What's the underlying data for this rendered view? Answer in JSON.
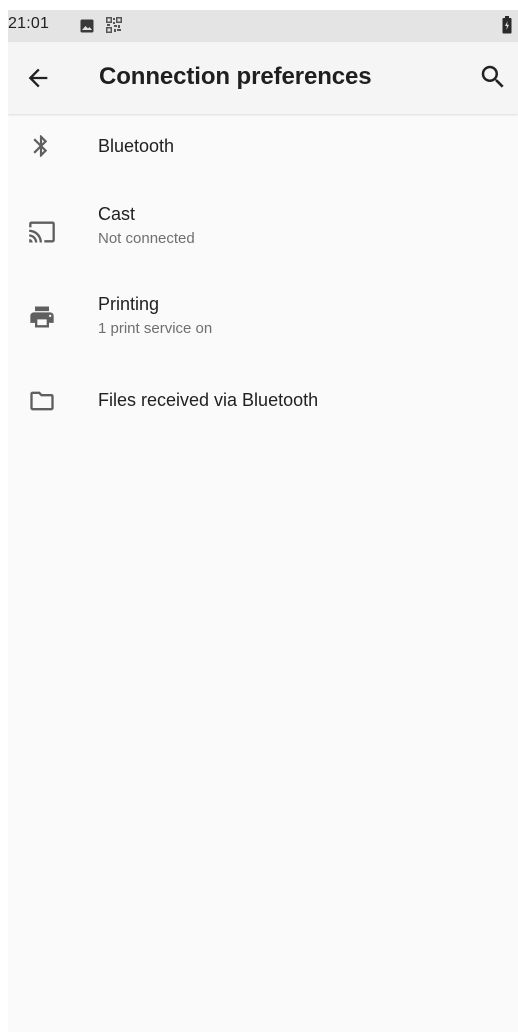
{
  "status_bar": {
    "time": "21:01",
    "icons": [
      "gallery-icon",
      "qr-code-icon",
      "battery-icon"
    ]
  },
  "app_bar": {
    "title": "Connection preferences",
    "back_icon": "arrow-back-icon",
    "search_icon": "search-icon"
  },
  "items": [
    {
      "title": "Bluetooth",
      "summary": "",
      "icon": "bluetooth-icon"
    },
    {
      "title": "Cast",
      "summary": "Not connected",
      "icon": "cast-icon"
    },
    {
      "title": "Printing",
      "summary": "1 print service on",
      "icon": "printer-icon"
    },
    {
      "title": "Files received via Bluetooth",
      "summary": "",
      "icon": "folder-icon"
    }
  ],
  "colors": {
    "status_bar": "#e4e4e4",
    "app_bar": "#f5f5f5",
    "background": "#fafafa",
    "icon": "#5f5f5f",
    "title_text": "#1f1f1f",
    "summary_text": "#6f6f6f"
  }
}
